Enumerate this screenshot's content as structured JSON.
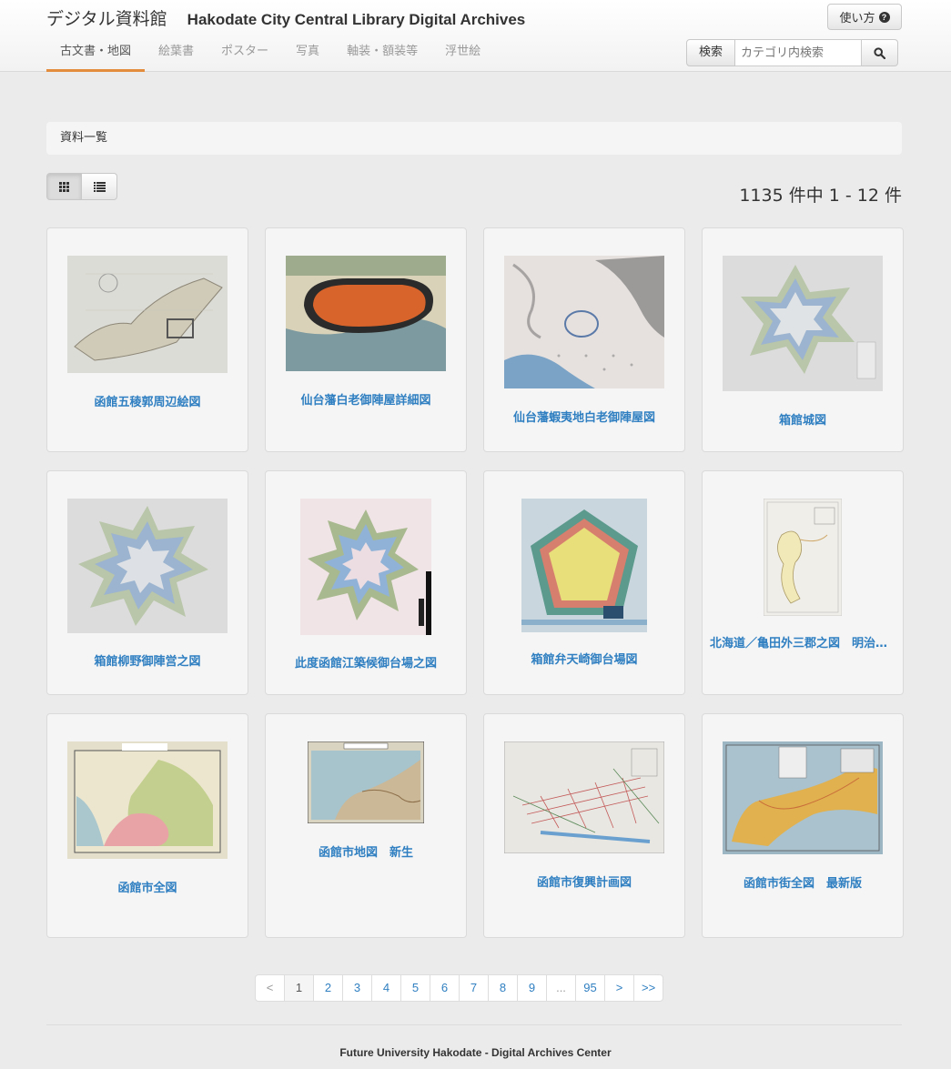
{
  "header": {
    "title_ja": "デジタル資料館",
    "title_en": "Hakodate City Central Library Digital Archives",
    "help_label": "使い方"
  },
  "tabs": [
    {
      "label": "古文書・地図",
      "active": true
    },
    {
      "label": "絵葉書",
      "active": false
    },
    {
      "label": "ポスター",
      "active": false
    },
    {
      "label": "写真",
      "active": false
    },
    {
      "label": "軸装・額装等",
      "active": false
    },
    {
      "label": "浮世絵",
      "active": false
    }
  ],
  "search": {
    "button_label": "検索",
    "placeholder": "カテゴリ内検索",
    "icon": "search-icon"
  },
  "breadcrumb": "資料一覧",
  "view_toggle": {
    "grid_icon": "grid-icon",
    "list_icon": "list-icon",
    "active": "grid"
  },
  "result_count": "1135 件中 1 - 12 件",
  "items": [
    {
      "title": "函館五稜郭周辺絵図"
    },
    {
      "title": "仙台藩白老御陣屋詳細図"
    },
    {
      "title": "仙台藩蝦夷地白老御陣屋図"
    },
    {
      "title": "箱館城図"
    },
    {
      "title": "箱館柳野御陣営之図"
    },
    {
      "title": "此度函館江築候御台場之図"
    },
    {
      "title": "箱館弁天崎御台場図"
    },
    {
      "title": "北海道／亀田外三郡之図　明治十六年製図"
    },
    {
      "title": "函館市全図"
    },
    {
      "title": "函館市地図　新生"
    },
    {
      "title": "函館市復興計画図"
    },
    {
      "title": "函館市街全図　最新版"
    }
  ],
  "pagination": {
    "prev": "<",
    "pages": [
      "1",
      "2",
      "3",
      "4",
      "5",
      "6",
      "7",
      "8",
      "9",
      "...",
      "95"
    ],
    "current": "1",
    "next": ">",
    "last": ">>"
  },
  "footer": "Future University Hakodate - Digital Archives Center",
  "colors": {
    "link": "#2f7fc1",
    "tab_active_underline": "#e38d3c",
    "background": "#ebebeb"
  }
}
